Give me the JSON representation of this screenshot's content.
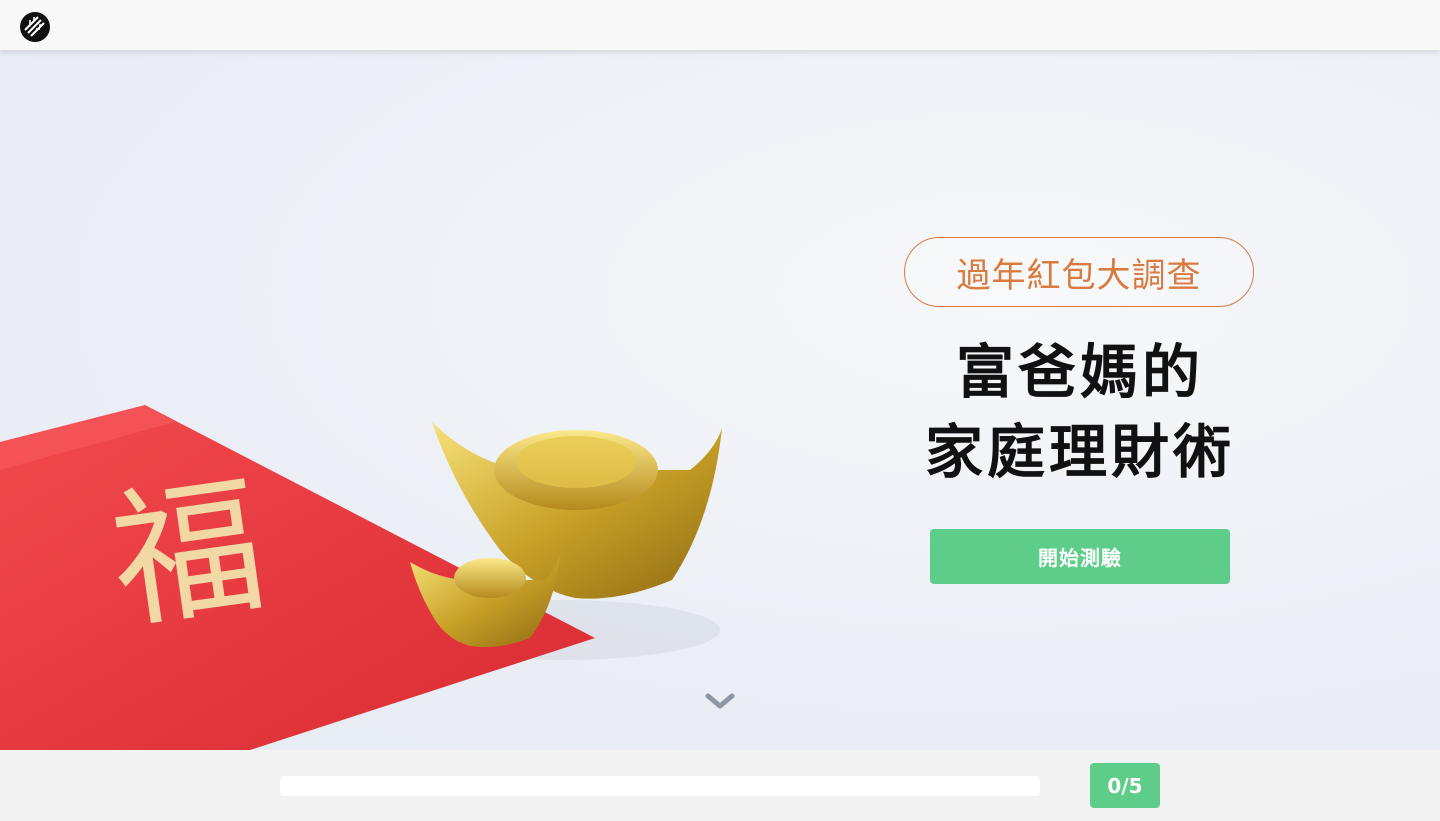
{
  "header": {
    "logo_icon": "brand-logo-icon"
  },
  "hero": {
    "badge": "過年紅包大調查",
    "title_line1": "富爸媽的",
    "title_line2": "家庭理財術",
    "start_button_label": "開始測驗",
    "scroll_icon": "chevron-down-icon",
    "envelope_glyph": "福"
  },
  "progress": {
    "label": "0/5",
    "completed": 0,
    "total": 5
  },
  "colors": {
    "accent_green": "#5fcd8a",
    "badge_orange": "#d97a3f",
    "envelope_red": "#e63b3f",
    "gold": "#d8b13a"
  }
}
